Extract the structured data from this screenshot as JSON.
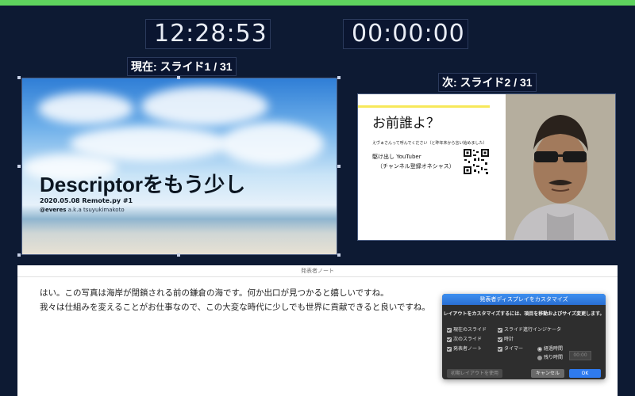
{
  "clock": {
    "current_time": "12:28:53",
    "elapsed_timer": "00:00:00"
  },
  "current_slide": {
    "label": "現在: スライド1 / 31",
    "title": "Descriptorをもう少し",
    "subtitle": "2020.05.08 Remote.py #1",
    "author_handle": "@everes",
    "author_aka": " a.k.a tsuyukimakoto"
  },
  "next_slide": {
    "label": "次: スライド2 / 31",
    "title": "お前誰よ？",
    "note_small": "えヴぁさんって呼んでください（と昨年末から言い始めました）",
    "youtuber_line": "駆け出し YouTuber",
    "channel_line": "（チャンネル登録オネシャス）"
  },
  "notes": {
    "header": "発表者ノート",
    "lines": [
      "はい。この写真は海岸が閉鎖される前の鎌倉の海です。何か出口が見つかると嬉しいですね。",
      "我々は仕組みを変えることがお仕事なので、この大変な時代に少しでも世界に貢献できると良いですね。"
    ]
  },
  "dialog": {
    "title": "発表者ディスプレイをカスタマイズ",
    "description": "レイアウトをカスタマイズするには、項目を移動およびサイズ変更します。",
    "options": {
      "current_slide": "現在のスライド",
      "next_slide": "次のスライド",
      "presenter_notes": "発表者ノート",
      "progress_indicator": "スライド進行インジケータ",
      "clock": "時計",
      "timer": "タイマー",
      "elapsed": "経過時間",
      "remaining": "残り時間"
    },
    "remaining_value": "00:00",
    "reset_button": "初期レイアウトを使用",
    "cancel_button": "キャンセル",
    "ok_button": "OK"
  },
  "colors": {
    "accent_bar": "#5ed35e",
    "background": "#0d1a33",
    "dialog_primary": "#2f7bef"
  }
}
